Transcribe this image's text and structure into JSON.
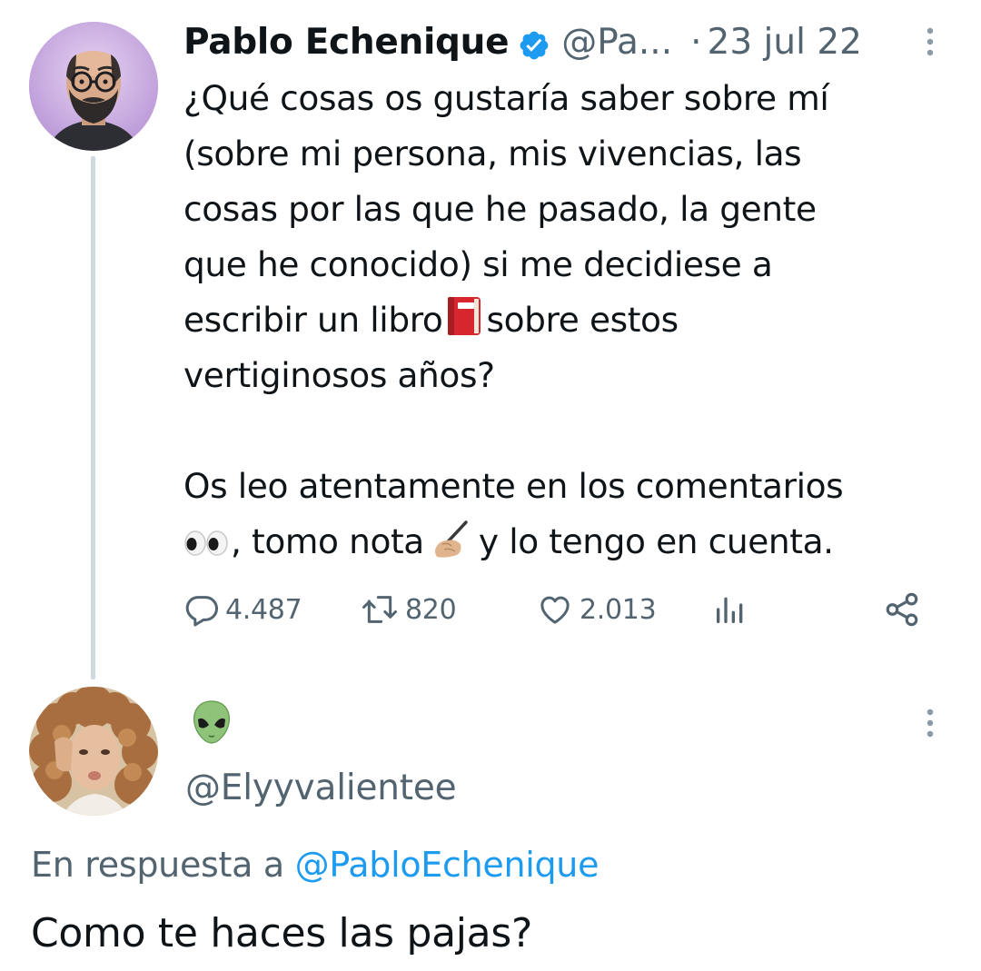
{
  "tweet": {
    "author_name": "Pablo Echenique",
    "handle": "@Pa...",
    "separator": "·",
    "date": "23 jul 22",
    "verified": true,
    "text_lines": [
      "¿Qué cosas os gustaría saber sobre mí",
      "(sobre mi persona, mis vivencias, las",
      "cosas por las que he pasado, la gente",
      "que he conocido) si me decidiese a",
      "escribir un libro",
      "sobre estos",
      "vertiginosos años?",
      "Os leo atentamente en los comentarios",
      ", tomo nota",
      "y lo tengo en cuenta."
    ],
    "emojis": [
      "closed-book-emoji",
      "eyes-emoji",
      "writing-hand-emoji"
    ],
    "stats": {
      "replies": "4.487",
      "retweets": "820",
      "likes": "2.013"
    },
    "icons": [
      "verified-badge-icon",
      "more-options-icon",
      "reply-icon",
      "retweet-icon",
      "like-icon",
      "views-icon",
      "share-icon"
    ]
  },
  "reply": {
    "display_name_emoji": "alien-emoji",
    "handle": "@Elyyvalientee",
    "replying_prefix": "En respuesta a",
    "replying_to": "@PabloEchenique",
    "text": "Como te haces las pajas?"
  },
  "colors": {
    "text_primary": "#0f1419",
    "text_secondary": "#536471",
    "link": "#1d9bf0",
    "verified": "#1d9bf0",
    "thread_line": "#cfd9de"
  }
}
